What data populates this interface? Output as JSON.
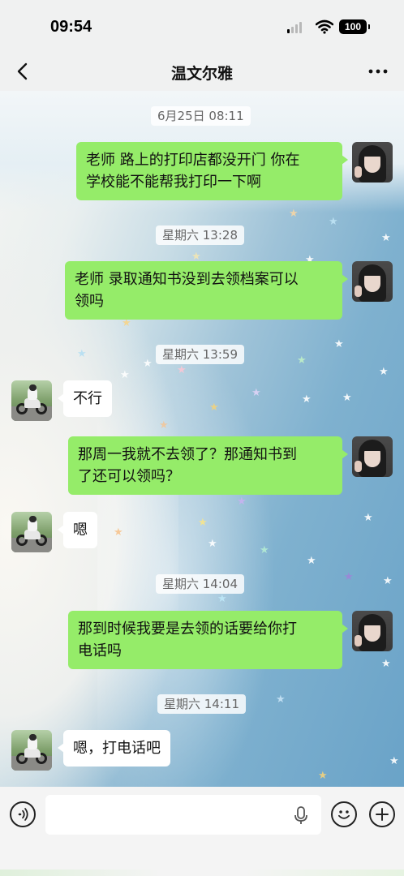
{
  "status_bar": {
    "time": "09:54",
    "battery": "100"
  },
  "nav": {
    "title": "温文尔雅",
    "back_icon": "chevron-left-icon",
    "more_icon": "more-dots-icon"
  },
  "messages": [
    {
      "type": "time",
      "text": "6月25日 08:11"
    },
    {
      "type": "out",
      "lines": [
        "老师 路上的打印店都没开门 你在",
        "学校能不能帮我打印一下啊"
      ]
    },
    {
      "type": "time",
      "text": "星期六 13:28"
    },
    {
      "type": "out",
      "lines": [
        "老师 录取通知书没到去领档案可以",
        "领吗"
      ]
    },
    {
      "type": "time",
      "text": "星期六 13:59"
    },
    {
      "type": "in",
      "lines": [
        "不行"
      ]
    },
    {
      "type": "out",
      "lines": [
        "那周一我就不去领了？那通知书到",
        "了还可以领吗？"
      ]
    },
    {
      "type": "in",
      "lines": [
        "嗯"
      ]
    },
    {
      "type": "time",
      "text": "星期六 14:04"
    },
    {
      "type": "out",
      "lines": [
        "那到时候我要是去领的话要给你打",
        "电话吗"
      ]
    },
    {
      "type": "time",
      "text": "星期六 14:11"
    },
    {
      "type": "in",
      "lines": [
        "嗯，打电话吧"
      ]
    }
  ],
  "input_bar": {
    "placeholder": "",
    "icons": [
      "voice-mode-icon",
      "microphone-icon",
      "emoji-icon",
      "plus-icon"
    ]
  },
  "colors": {
    "outgoing_bubble": "#95ec69",
    "incoming_bubble": "#ffffff",
    "bar_background": "#f0f1f1"
  }
}
